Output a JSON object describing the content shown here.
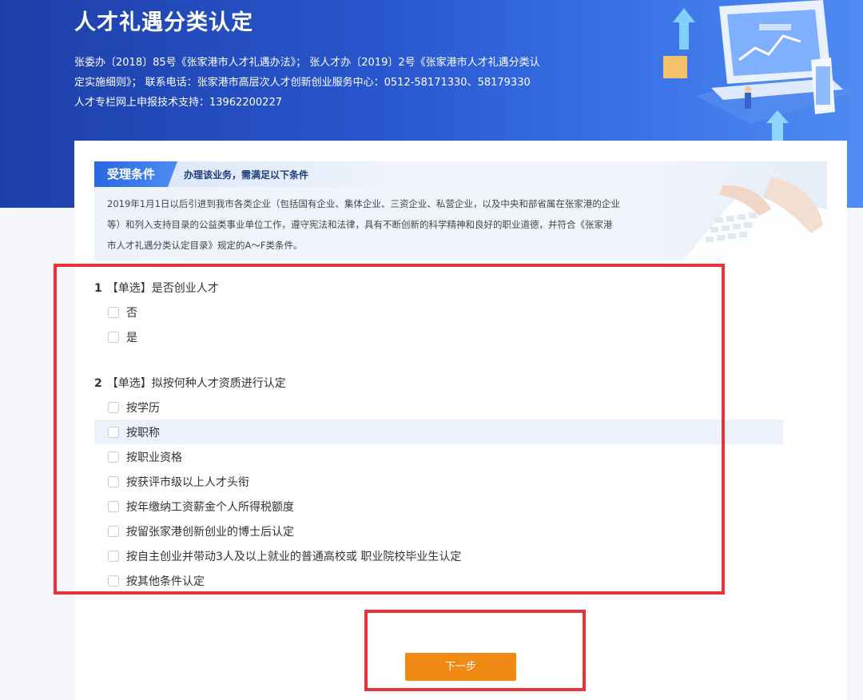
{
  "header": {
    "title": "人才礼遇分类认定",
    "desc_line1": "张委办〔2018〕85号《张家港市人才礼遇办法》； 张人才办〔2019〕2号《张家港市人才礼遇分类认",
    "desc_line2": "定实施细则》； 联系电话：张家港市高层次人才创新创业服务中心：0512-58171330、58179330",
    "desc_line3": "人才专栏网上申报技术支持：13962200227"
  },
  "notice": {
    "tag": "受理条件",
    "subtitle": "办理该业务，需满足以下条件",
    "body_line1": "2019年1月1日以后引进到我市各类企业（包括国有企业、集体企业、三资企业、私营企业，以及中央和部省属在张家港的企业",
    "body_line2": "等）和列入支持目录的公益类事业单位工作，遵守宪法和法律，具有不断创新的科学精神和良好的职业道德，并符合《张家港",
    "body_line3": "市人才礼遇分类认定目录》规定的A～F类条件。"
  },
  "questions": [
    {
      "num": "1",
      "title": "【单选】是否创业人才",
      "options": [
        "否",
        "是"
      ]
    },
    {
      "num": "2",
      "title": "【单选】拟按何种人才资质进行认定",
      "options": [
        "按学历",
        "按职称",
        "按职业资格",
        "按获评市级以上人才头衔",
        "按年缴纳工资薪金个人所得税额度",
        "按留张家港创新创业的博士后认定",
        "按自主创业并带动3人及以上就业的普通高校或 职业院校毕业生认定",
        "按其他条件认定"
      ]
    }
  ],
  "next_button": "下一步",
  "colors": {
    "accent": "#f08a12",
    "highlight_box": "#e8333a",
    "brand_blue": "#2a66e0"
  }
}
